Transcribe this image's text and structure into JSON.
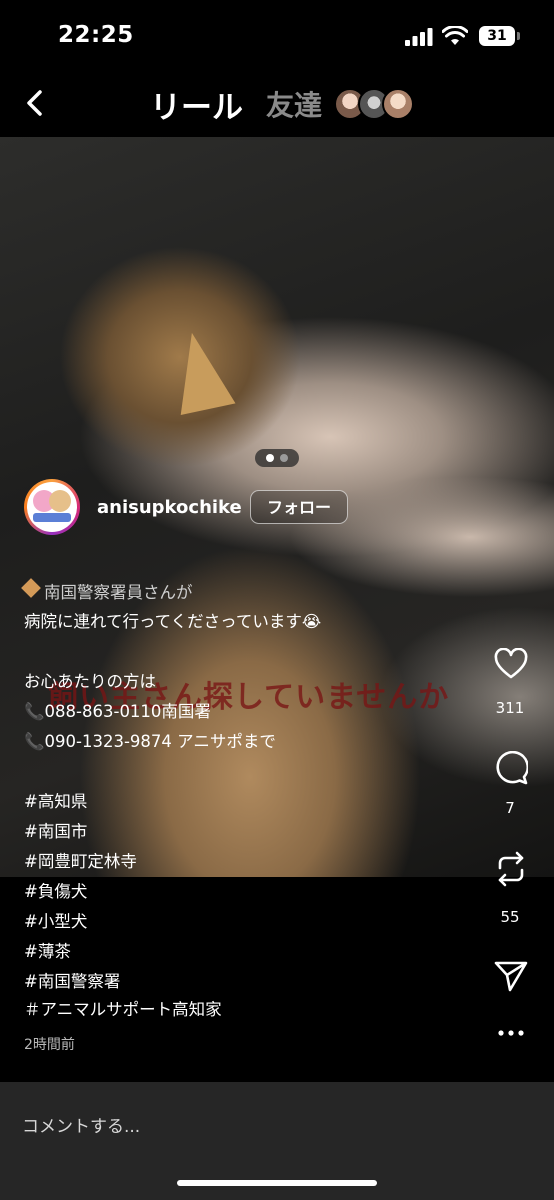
{
  "status_bar": {
    "time": "22:25",
    "battery": "31"
  },
  "header": {
    "title": "リール",
    "friends_tab": "友達"
  },
  "video": {
    "overlay_text": "飼い主さん探していませんか"
  },
  "account": {
    "username": "anisupkochike",
    "follow_label": "フォロー"
  },
  "caption": {
    "lines": [
      "南国警察署員さんが",
      "病院に連れて行ってくださっています😭",
      "お心あたりの方は",
      "📞088-863-0110南国署",
      "📞090-1323-9874 アニサポまで",
      "#高知県",
      "#南国市",
      "#岡豊町定林寺",
      "#負傷犬",
      "#小型犬",
      "#薄茶",
      "#南国警察署",
      "＃アニマルサポート高知家"
    ],
    "time_ago": "2時間前"
  },
  "actions": {
    "likes": "311",
    "comments": "7",
    "reposts": "55"
  },
  "comment_bar": {
    "placeholder": "コメントする..."
  },
  "icons": [
    "back-chevron-icon",
    "heart-icon",
    "comment-icon",
    "repost-icon",
    "send-icon",
    "more-icon"
  ]
}
